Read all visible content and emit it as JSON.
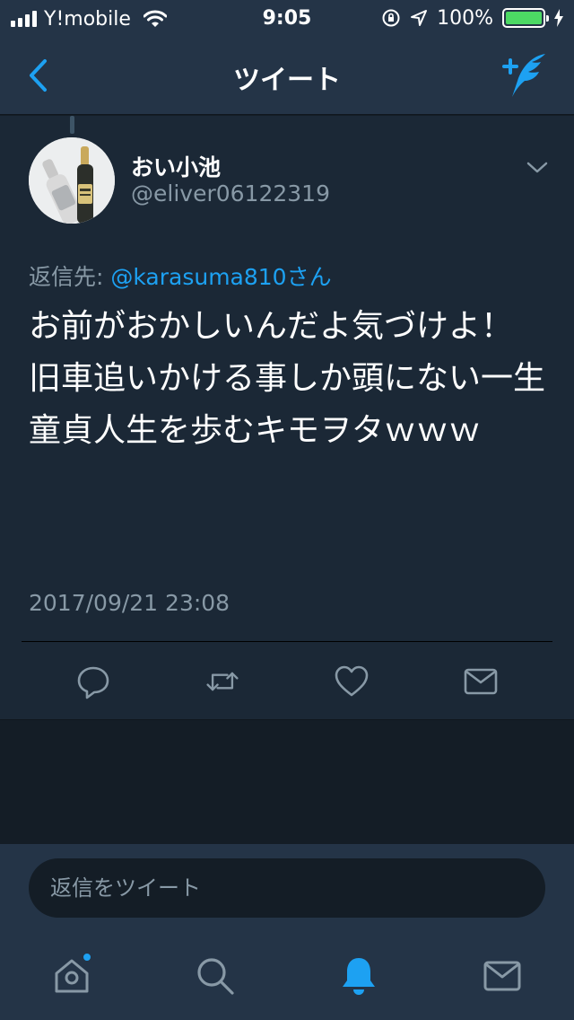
{
  "status_bar": {
    "carrier": "Y!mobile",
    "time": "9:05",
    "battery_percent": "100%",
    "signal_bars": 4
  },
  "nav": {
    "title": "ツイート",
    "back_icon": "chevron-left-icon",
    "compose_icon": "compose-tweet-icon"
  },
  "tweet": {
    "display_name": "おい小池",
    "handle": "@eliver06122319",
    "reply_label": "返信先: ",
    "reply_mention": "@karasuma810さん",
    "text": "お前がおかしいんだよ気づけよ！\n旧車追いかける事しか頭にない一生童貞人生を歩むキモヲタｗｗｗ",
    "timestamp": "2017/09/21 23:08"
  },
  "actions": [
    {
      "name": "reply",
      "icon": "reply-icon"
    },
    {
      "name": "retweet",
      "icon": "retweet-icon"
    },
    {
      "name": "like",
      "icon": "heart-icon"
    },
    {
      "name": "share",
      "icon": "mail-icon"
    }
  ],
  "reply_composer": {
    "placeholder": "返信をツイート"
  },
  "tab_bar": [
    {
      "name": "home",
      "icon": "home-icon",
      "has_badge": true
    },
    {
      "name": "search",
      "icon": "search-icon"
    },
    {
      "name": "notifications",
      "icon": "bell-icon",
      "active": true
    },
    {
      "name": "messages",
      "icon": "mail-icon"
    }
  ],
  "colors": {
    "accent": "#1da1f2",
    "header_bg": "#243447",
    "card_bg": "#1b2836",
    "page_bg": "#141d26",
    "secondary_text": "#8899a6",
    "battery": "#4cd964"
  }
}
